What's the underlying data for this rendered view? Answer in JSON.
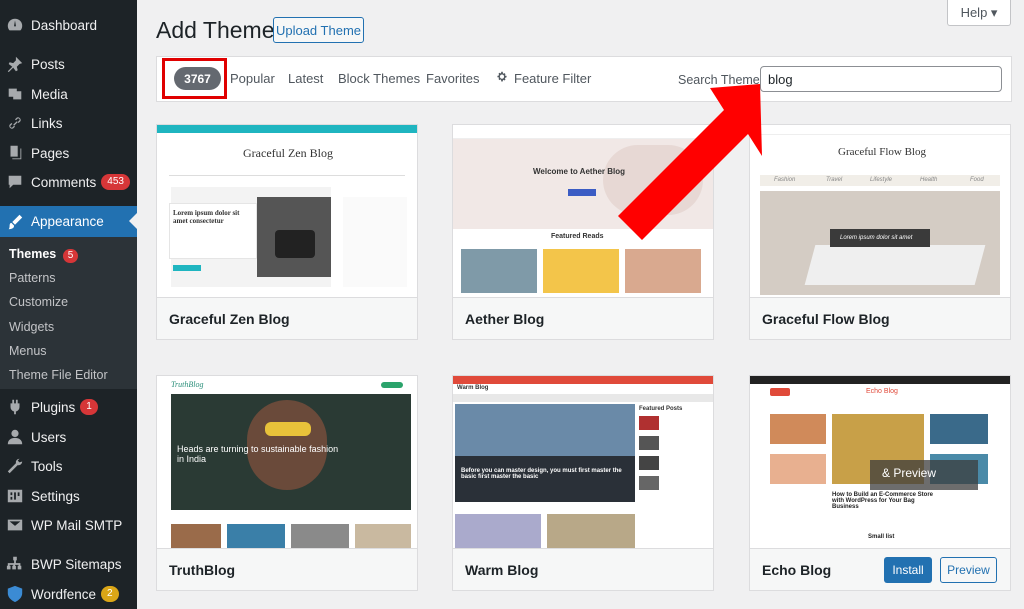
{
  "sidebar": {
    "items": [
      {
        "label": "Dashboard",
        "icon": "dashboard-icon"
      },
      {
        "label": "Posts",
        "icon": "pin-icon"
      },
      {
        "label": "Media",
        "icon": "media-icon"
      },
      {
        "label": "Links",
        "icon": "link-icon"
      },
      {
        "label": "Pages",
        "icon": "pages-icon"
      },
      {
        "label": "Comments",
        "icon": "comment-icon",
        "count": "453"
      },
      {
        "label": "Appearance",
        "icon": "brush-icon"
      },
      {
        "label": "Plugins",
        "icon": "plugin-icon",
        "count": "1"
      },
      {
        "label": "Users",
        "icon": "user-icon"
      },
      {
        "label": "Tools",
        "icon": "wrench-icon"
      },
      {
        "label": "Settings",
        "icon": "settings-icon"
      },
      {
        "label": "WP Mail SMTP",
        "icon": "mail-icon"
      },
      {
        "label": "BWP Sitemaps",
        "icon": "sitemap-icon"
      },
      {
        "label": "Wordfence",
        "icon": "shield-icon",
        "count": "2"
      }
    ],
    "submenu": [
      {
        "label": "Themes",
        "count": "5"
      },
      {
        "label": "Patterns"
      },
      {
        "label": "Customize"
      },
      {
        "label": "Widgets"
      },
      {
        "label": "Menus"
      },
      {
        "label": "Theme File Editor"
      }
    ]
  },
  "header": {
    "title": "Add Themes",
    "upload_label": "Upload Theme",
    "help_label": "Help ▾"
  },
  "filter": {
    "count": "3767",
    "links": [
      "Popular",
      "Latest",
      "Block Themes",
      "Favorites",
      "Feature Filter"
    ],
    "search_label": "Search Themes",
    "search_value": "blog"
  },
  "themes": [
    {
      "name": "Graceful Zen Blog",
      "site_title": "Graceful Zen Blog",
      "hero": "Lorem ipsum dolor sit amet consectetur"
    },
    {
      "name": "Aether Blog",
      "site_title": "Aether Blog",
      "hero": "Welcome to Aether Blog",
      "section": "Featured Reads"
    },
    {
      "name": "Graceful Flow Blog",
      "site_title": "Graceful Flow Blog",
      "hero": "Lorem ipsum dolor sit amet",
      "tabs": [
        "Fashion",
        "Travel",
        "Lifestyle",
        "Health",
        "Food"
      ]
    },
    {
      "name": "TruthBlog",
      "site_title": "TruthBlog",
      "hero": "Heads are turning to sustainable fashion in India"
    },
    {
      "name": "Warm Blog",
      "site_title": "Warm Blog",
      "hero": "Before you can master design, you must first master the basic first master the basic",
      "side": "Featured Posts"
    },
    {
      "name": "Echo Blog",
      "site_title": "Echo Blog",
      "overlay": "& Preview",
      "install_label": "Install",
      "preview_label": "Preview",
      "caption": "How to Build an E-Commerce Store with WordPress for Your Bag Business",
      "section": "Small list"
    }
  ],
  "colors": {
    "accent": "#2271b1",
    "sidebar": "#1d2327",
    "highlight": "#e00000",
    "badge": "#d63638"
  }
}
